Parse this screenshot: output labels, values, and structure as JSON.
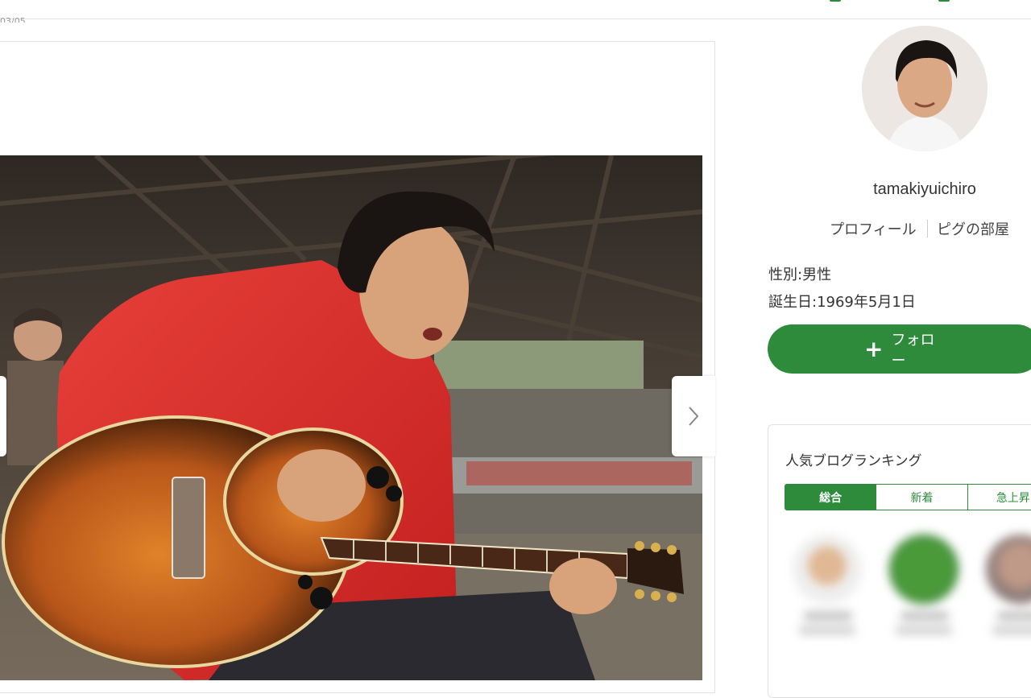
{
  "header": {
    "date_fragment": "03/05"
  },
  "main": {
    "photo_alt": "",
    "next_icon": "chevron-right-icon"
  },
  "profile": {
    "username": "tamakiyuichiro",
    "link_profile": "プロフィール",
    "link_room": "ピグの部屋",
    "gender": "性別:男性",
    "birthday": "誕生日:1969年5月1日",
    "follow_label": "フォロー",
    "follow_icon": "plus-icon"
  },
  "ranking": {
    "title": "人気ブログランキング",
    "tabs": [
      "総合",
      "新着",
      "急上昇"
    ],
    "active_tab": "総合"
  },
  "colors": {
    "accent": "#2e8b3b"
  }
}
